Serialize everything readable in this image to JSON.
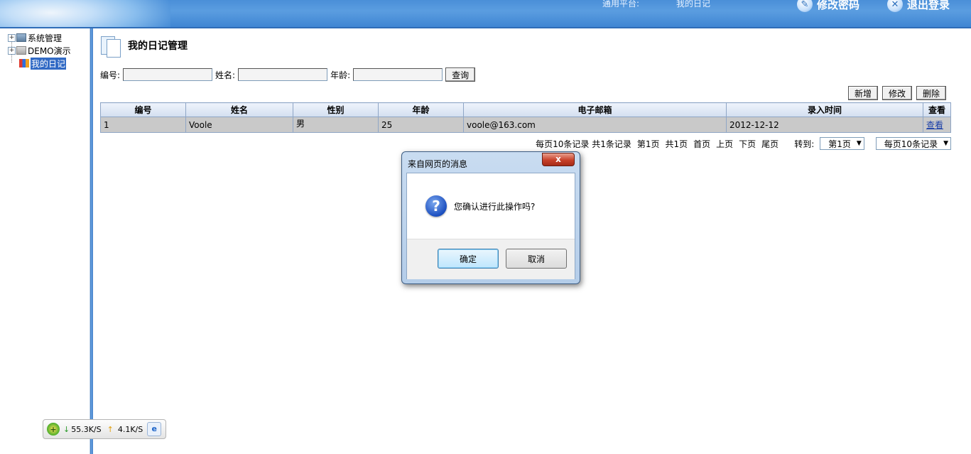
{
  "header": {
    "platform_label": "通用平台:",
    "current_module": "我的日记",
    "change_password_label": "修改密码",
    "logout_label": "退出登录"
  },
  "sidebar": {
    "items": [
      {
        "label": "系统管理",
        "icon": "computer-icon"
      },
      {
        "label": "DEMO演示",
        "icon": "folder-icon"
      },
      {
        "label": "我的日记",
        "icon": "cube-icon",
        "selected": true
      }
    ]
  },
  "main": {
    "title": "我的日记管理",
    "search": {
      "id_label": "编号:",
      "id_value": "",
      "name_label": "姓名:",
      "name_value": "",
      "age_label": "年龄:",
      "age_value": "",
      "query_label": "查询"
    },
    "toolbar": {
      "add_label": "新增",
      "edit_label": "修改",
      "delete_label": "删除"
    },
    "table": {
      "columns": [
        "编号",
        "姓名",
        "性别",
        "年龄",
        "电子邮箱",
        "录入时间",
        "查看"
      ],
      "rows": [
        {
          "id": "1",
          "name": "Voole",
          "gender": "男",
          "age": "25",
          "email": "voole@163.com",
          "time": "2012-12-12",
          "view": "查看"
        }
      ]
    },
    "pager": {
      "summary": "每页10条记录 共1条记录",
      "current": "第1页",
      "total": "共1页",
      "first": "首页",
      "prev": "上页",
      "next": "下页",
      "last": "尾页",
      "goto_label": "转到:",
      "page_select": "第1页",
      "size_select": "每页10条记录"
    }
  },
  "dialog": {
    "title": "来自网页的消息",
    "message": "您确认进行此操作吗?",
    "ok_label": "确定",
    "cancel_label": "取消",
    "close_symbol": "x"
  },
  "speed_widget": {
    "download": "55.3K/S",
    "upload": "4.1K/S"
  }
}
